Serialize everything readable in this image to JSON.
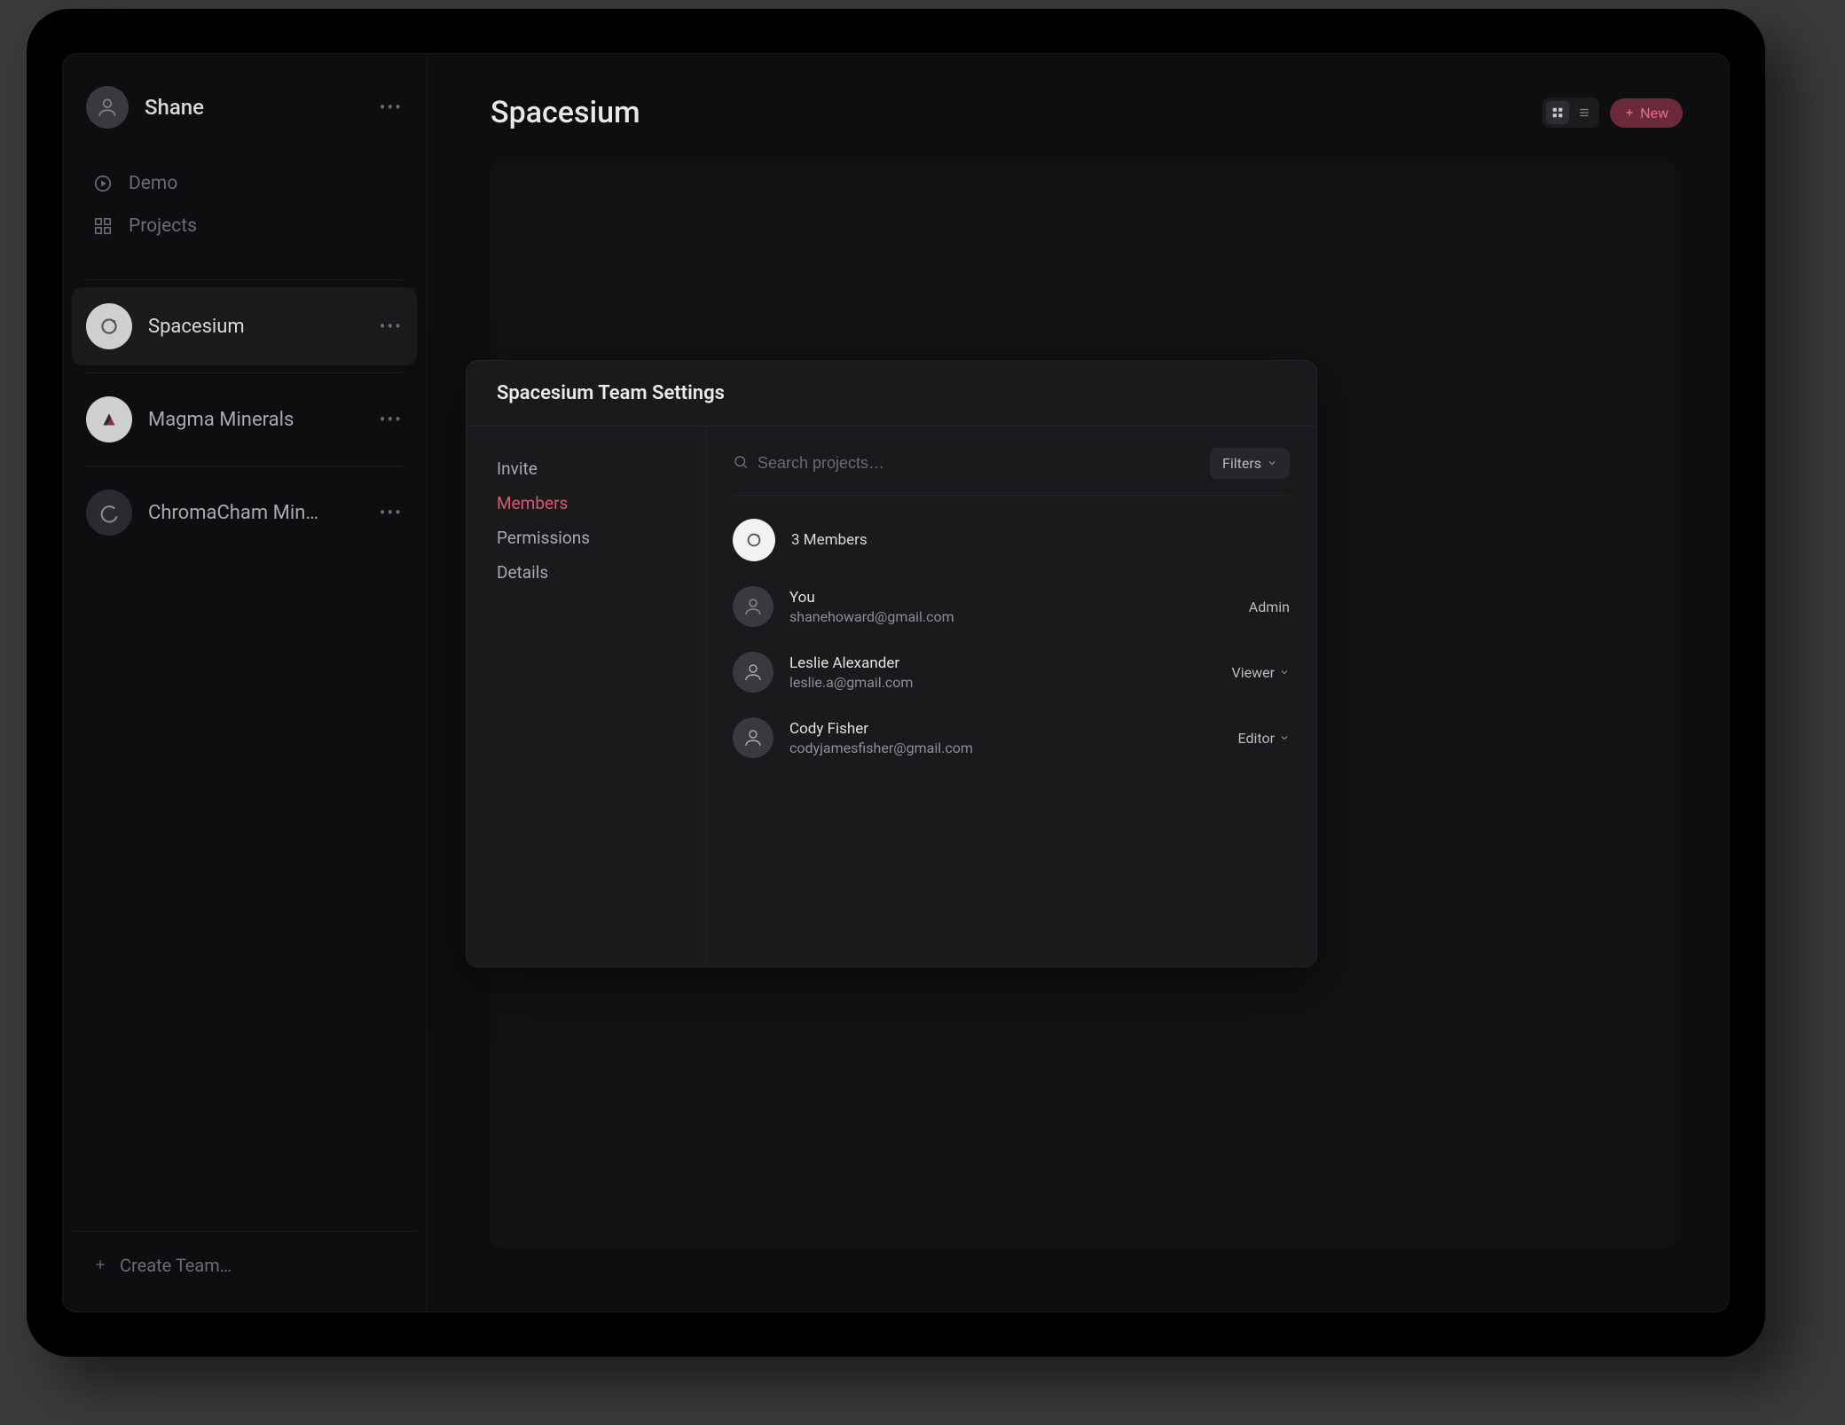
{
  "sidebar": {
    "user": {
      "name": "Shane"
    },
    "nav": [
      {
        "label": "Demo",
        "icon": "play-circle"
      },
      {
        "label": "Projects",
        "icon": "grid"
      }
    ],
    "teams": [
      {
        "label": "Spacesium",
        "active": true
      },
      {
        "label": "Magma Minerals",
        "active": false
      },
      {
        "label": "ChromaCham Min…",
        "active": false
      }
    ],
    "create_label": "Create Team…"
  },
  "header": {
    "title": "Spacesium",
    "new_label": "New"
  },
  "modal": {
    "title": "Spacesium Team Settings",
    "nav": [
      {
        "label": "Invite",
        "active": false
      },
      {
        "label": "Members",
        "active": true
      },
      {
        "label": "Permissions",
        "active": false
      },
      {
        "label": "Details",
        "active": false
      }
    ],
    "search_placeholder": "Search projects…",
    "filters_label": "Filters",
    "summary": "3 Members",
    "members": [
      {
        "name": "You",
        "email": "shanehoward@gmail.com",
        "role": "Admin",
        "dropdown": false
      },
      {
        "name": "Leslie Alexander",
        "email": "leslie.a@gmail.com",
        "role": "Viewer",
        "dropdown": true
      },
      {
        "name": "Cody Fisher",
        "email": "codyjamesfisher@gmail.com",
        "role": "Editor",
        "dropdown": true
      }
    ]
  },
  "colors": {
    "accent": "#d35a72"
  }
}
